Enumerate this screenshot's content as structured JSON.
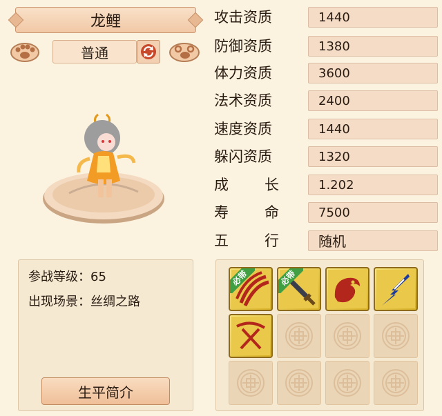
{
  "pet": {
    "name": "龙鲤",
    "type": "普通"
  },
  "stats": [
    {
      "label": "攻击资质",
      "value": "1440"
    },
    {
      "label": "防御资质",
      "value": "1380"
    },
    {
      "label": "体力资质",
      "value": "3600"
    },
    {
      "label": "法术资质",
      "value": "2400"
    },
    {
      "label": "速度资质",
      "value": "1440"
    },
    {
      "label": "躲闪资质",
      "value": "1320"
    },
    {
      "label_left": "成",
      "label_right": "长",
      "value": "1.202"
    },
    {
      "label_left": "寿",
      "label_right": "命",
      "value": "7500"
    },
    {
      "label_left": "五",
      "label_right": "行",
      "value": "随机"
    }
  ],
  "info": {
    "level_label": "参战等级：",
    "level_value": "65",
    "scene_label": "出现场景：",
    "scene_value": "丝绸之路",
    "bio_button": "生平简介"
  },
  "skills": {
    "must_tag": "必带",
    "items": [
      {
        "icon": "claw-slash-skill-icon",
        "required": true
      },
      {
        "icon": "sword-skill-icon",
        "required": true
      },
      {
        "icon": "dragon-skill-icon",
        "required": false
      },
      {
        "icon": "lightning-skill-icon",
        "required": false
      },
      {
        "icon": "crossed-swords-skill-icon",
        "required": false
      }
    ],
    "empty_slot_icon": "empty-slot-ornament-icon"
  },
  "colors": {
    "background": "#fbf3df",
    "skill_gold": "#e9c84a",
    "must_green": "#3f9f42"
  }
}
